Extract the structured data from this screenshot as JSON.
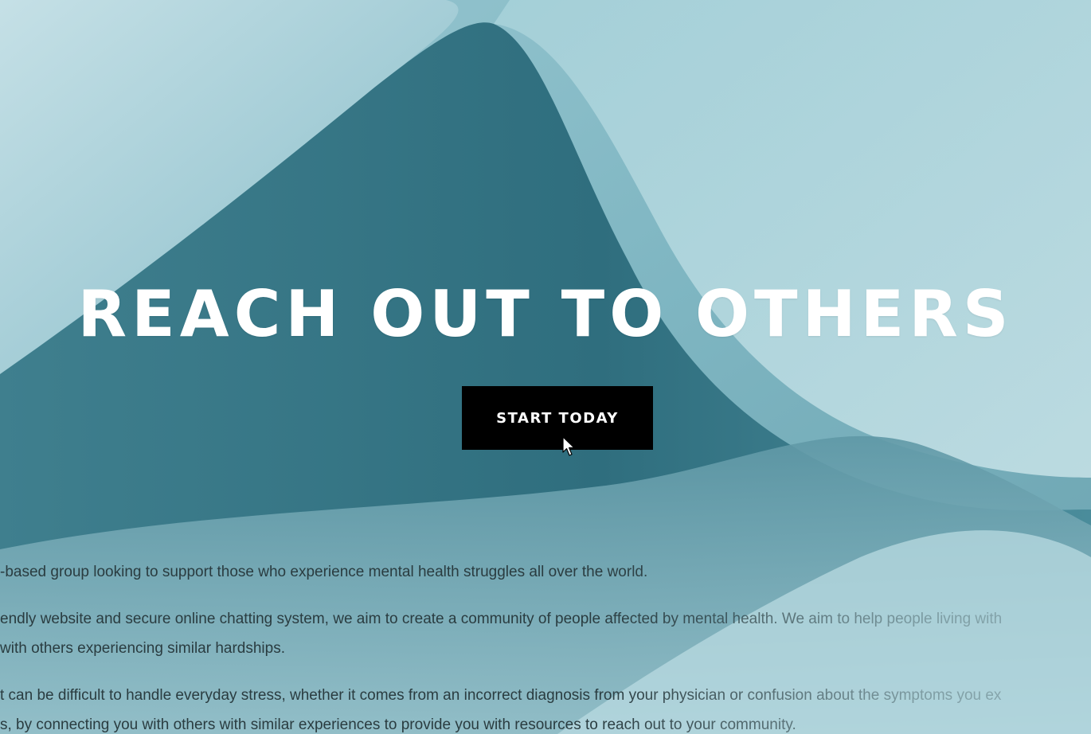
{
  "hero": {
    "title": "REACH OUT TO OTHERS",
    "cta_label": "START TODAY"
  },
  "about": {
    "paragraph_1": "-based group looking to support those who experience mental health struggles all over the world.",
    "paragraph_2_line_1": "endly website and secure online chatting system, we aim to create a community of people affected by mental health. We aim to help people living with",
    "paragraph_2_line_2": " with others experiencing similar hardships.",
    "paragraph_3_line_1": "t can be difficult to handle everyday  stress, whether it comes from an incorrect diagnosis from your physician or confusion about the symptoms you ex",
    "paragraph_3_line_2": "s, by connecting you with others with similar experiences to provide you with resources to reach out to your community."
  },
  "icons": {
    "cursor": "mouse-pointer-icon"
  },
  "colors": {
    "cta_background": "#000000",
    "cta_text": "#ffffff",
    "title_text": "#ffffff",
    "body_text": "#2a3c40",
    "backdrop": "#79b1bd"
  }
}
